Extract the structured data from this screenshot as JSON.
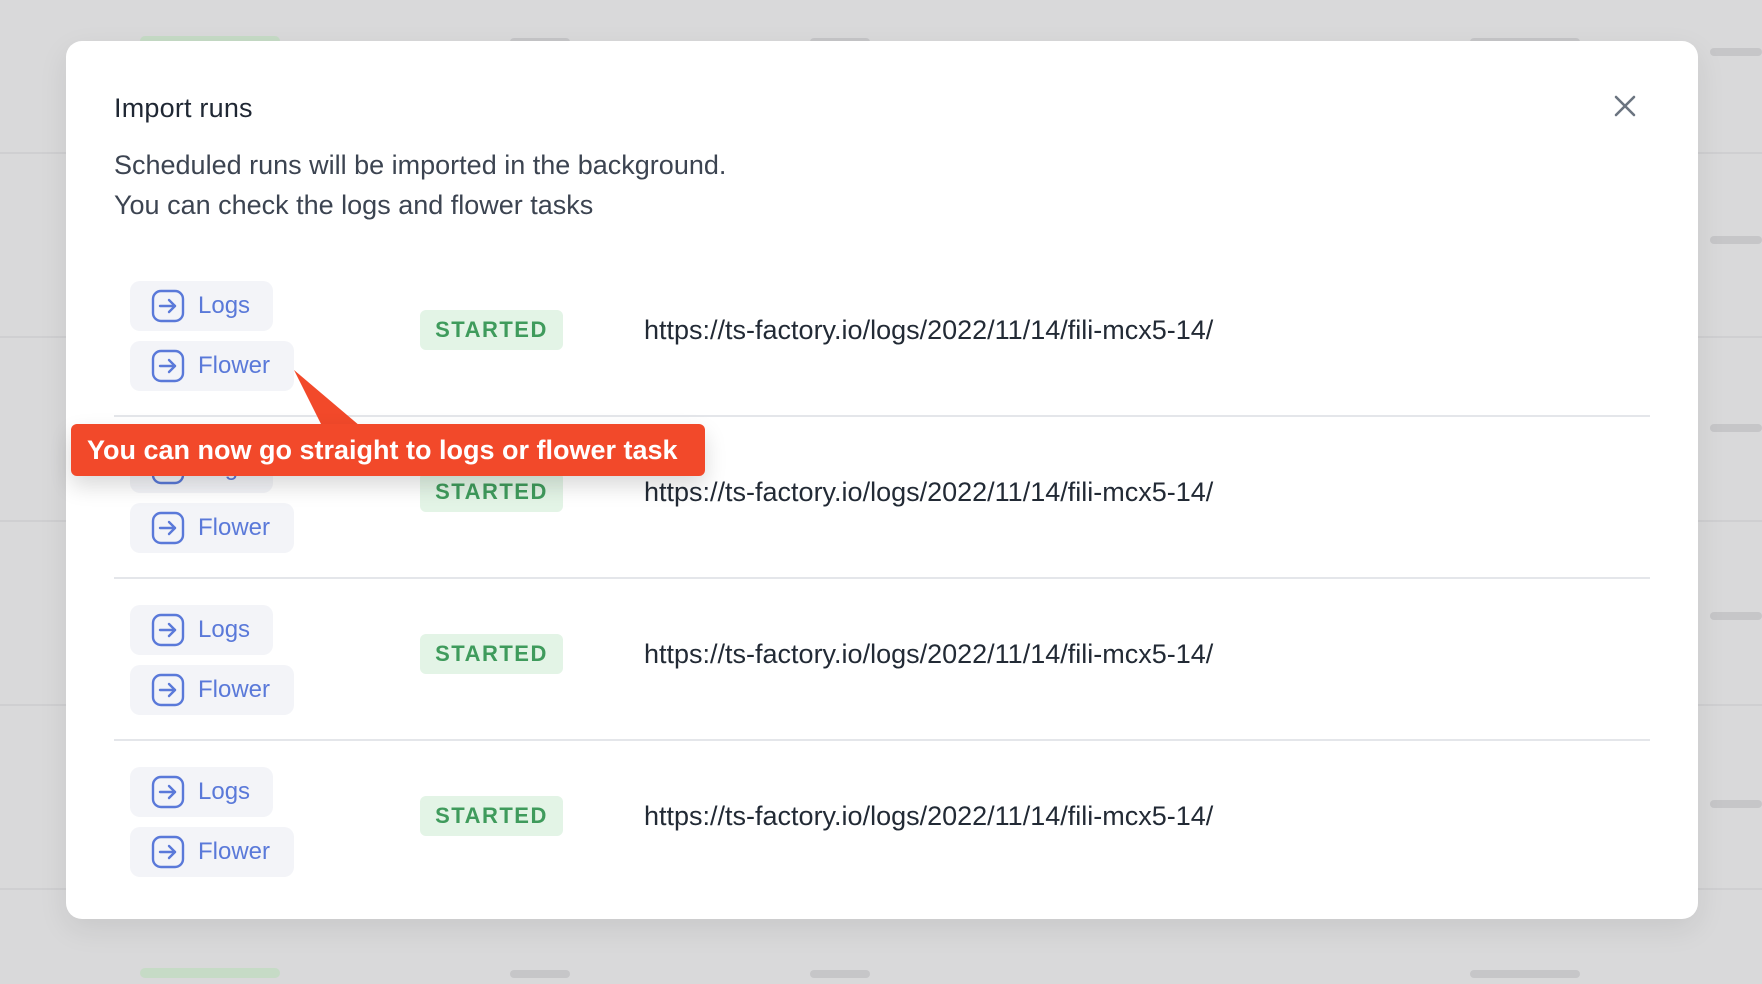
{
  "modal": {
    "title": "Import runs",
    "description_line1": "Scheduled runs will be imported in the background.",
    "description_line2": "You can check the logs and flower tasks"
  },
  "runs": [
    {
      "logs_label": "Logs",
      "flower_label": "Flower",
      "status": "STARTED",
      "url": "https://ts-factory.io/logs/2022/11/14/fili-mcx5-14/"
    },
    {
      "logs_label": "Logs",
      "flower_label": "Flower",
      "status": "STARTED",
      "url": "https://ts-factory.io/logs/2022/11/14/fili-mcx5-14/"
    },
    {
      "logs_label": "Logs",
      "flower_label": "Flower",
      "status": "STARTED",
      "url": "https://ts-factory.io/logs/2022/11/14/fili-mcx5-14/"
    },
    {
      "logs_label": "Logs",
      "flower_label": "Flower",
      "status": "STARTED",
      "url": "https://ts-factory.io/logs/2022/11/14/fili-mcx5-14/"
    }
  ],
  "callout": {
    "text": "You can now go straight to logs or flower task"
  },
  "icons": {
    "close": "close-icon",
    "link": "arrow-right-box-icon"
  },
  "colors": {
    "link": "#5a79d9",
    "status_bg": "#e3f4e6",
    "status_text": "#3f9b5c",
    "callout": "#f2492a"
  }
}
